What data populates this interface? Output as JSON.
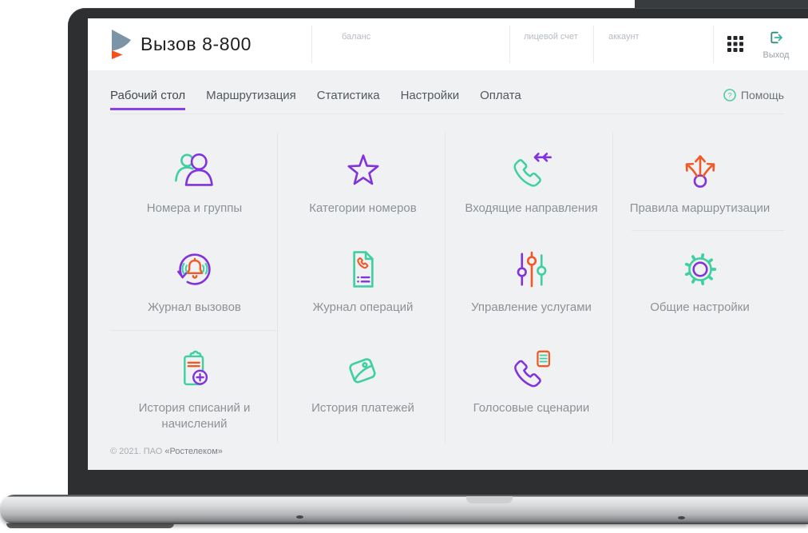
{
  "header": {
    "title": "Вызов 8-800",
    "fields": [
      {
        "label": "баланс"
      },
      {
        "label": "лицевой счет"
      },
      {
        "label": "аккаунт"
      }
    ],
    "logout_label": "Выход"
  },
  "nav": {
    "tabs": [
      {
        "label": "Рабочий стол",
        "active": true
      },
      {
        "label": "Маршрутизация",
        "active": false
      },
      {
        "label": "Статистика",
        "active": false
      },
      {
        "label": "Настройки",
        "active": false
      },
      {
        "label": "Оплата",
        "active": false
      }
    ],
    "help_label": "Помощь"
  },
  "tiles": [
    {
      "label": "Номера и группы",
      "icon": "users-icon"
    },
    {
      "label": "Категории номеров",
      "icon": "star-icon"
    },
    {
      "label": "Входящие направления",
      "icon": "incoming-call-icon"
    },
    {
      "label": "Правила маршрутизации",
      "icon": "routing-arrows-icon"
    },
    {
      "label": "Журнал вызовов",
      "icon": "call-log-icon"
    },
    {
      "label": "Журнал операций",
      "icon": "operations-log-icon"
    },
    {
      "label": "Управление услугами",
      "icon": "sliders-icon"
    },
    {
      "label": "Общие настройки",
      "icon": "gear-icon"
    },
    {
      "label": "История списаний и начислений",
      "icon": "charges-history-icon"
    },
    {
      "label": "История платежей",
      "icon": "payments-history-icon"
    },
    {
      "label": "Голосовые сценарии",
      "icon": "voice-scenarios-icon"
    }
  ],
  "footer": {
    "copyright_prefix": "© 2021. ПАО ",
    "company": "«Ростелеком»"
  },
  "colors": {
    "purple": "#8333dd",
    "green": "#3fd0a2",
    "orange": "#f05a28",
    "tab_accent": "#8a3fe8",
    "bezel": "#2d2f31"
  }
}
